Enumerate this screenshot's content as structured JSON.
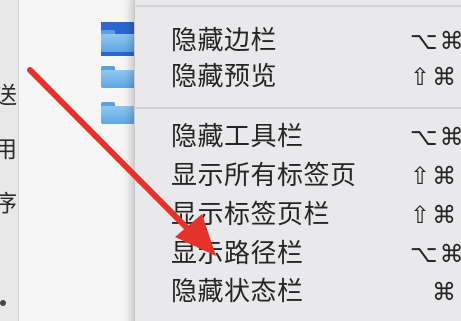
{
  "sidebar": {
    "chars": [
      "送",
      "用",
      "序"
    ]
  },
  "menu": {
    "items": [
      {
        "label": "隐藏边栏",
        "shortcut": "⌥⌘"
      },
      {
        "label": "隐藏预览",
        "shortcut": "⇧⌘"
      },
      {
        "label": "隐藏工具栏",
        "shortcut": "⌥⌘"
      },
      {
        "label": "显示所有标签页",
        "shortcut": "⇧⌘"
      },
      {
        "label": "显示标签页栏",
        "shortcut": "⇧⌘"
      },
      {
        "label": "显示路径栏",
        "shortcut": "⌥⌘"
      },
      {
        "label": "隐藏状态栏",
        "shortcut": "⌘"
      }
    ]
  },
  "colors": {
    "arrow": "#e5322b",
    "selection": "#2b67d2"
  },
  "icons": {
    "folder": "folder-icon",
    "arrow": "red-pointer-arrow"
  }
}
